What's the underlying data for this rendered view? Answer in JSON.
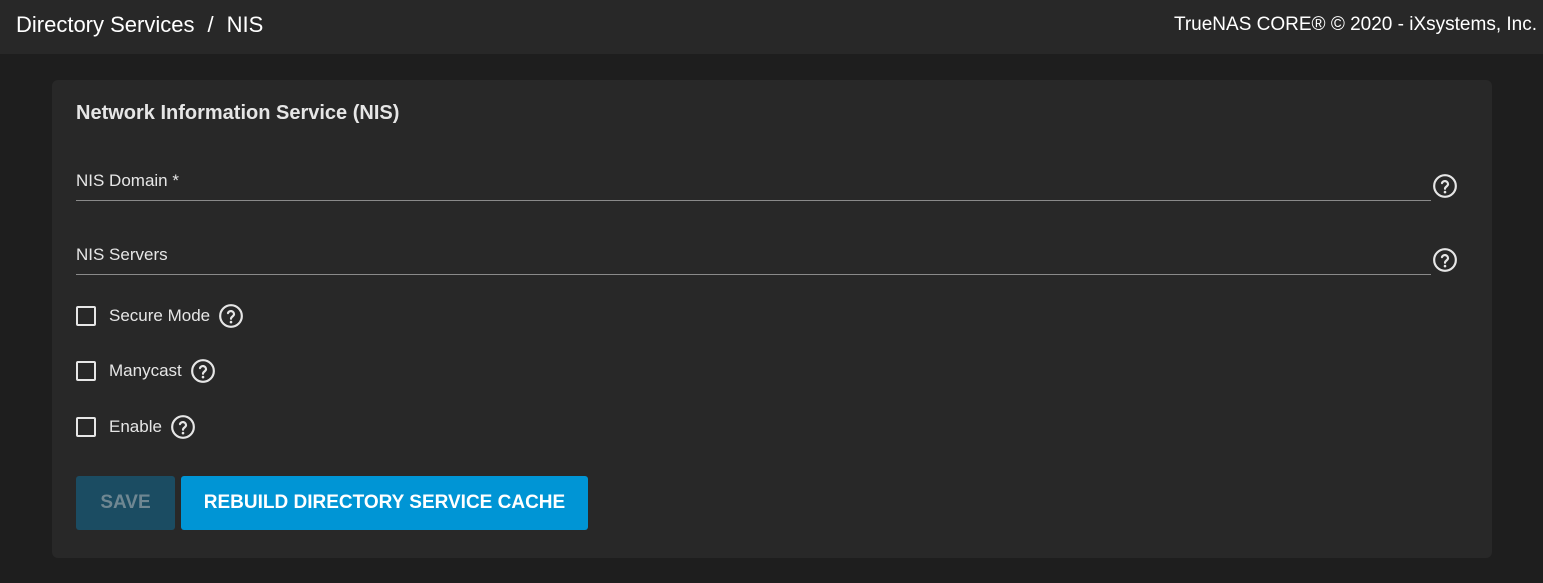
{
  "header": {
    "breadcrumb": [
      "Directory Services",
      "NIS"
    ],
    "separator": "/",
    "copyright": "TrueNAS CORE® © 2020 - iXsystems, Inc."
  },
  "form": {
    "title": "Network Information Service (NIS)",
    "fields": [
      {
        "label": "NIS Domain *",
        "value": "",
        "placeholder": ""
      },
      {
        "label": "NIS Servers",
        "value": "",
        "placeholder": ""
      }
    ],
    "checkboxes": [
      {
        "label": "Secure Mode",
        "checked": false
      },
      {
        "label": "Manycast",
        "checked": false
      },
      {
        "label": "Enable",
        "checked": false
      }
    ],
    "buttons": {
      "save": {
        "label": "Save",
        "disabled": true
      },
      "rebuild": {
        "label": "Rebuild Directory Service Cache",
        "disabled": false
      }
    }
  },
  "icons": {
    "help": "help-circle-icon"
  },
  "colors": {
    "background": "#1e1e1e",
    "panel": "#282828",
    "primary": "#0095d5",
    "primary_disabled": "#1b4c62",
    "text": "#e6e6e6"
  }
}
